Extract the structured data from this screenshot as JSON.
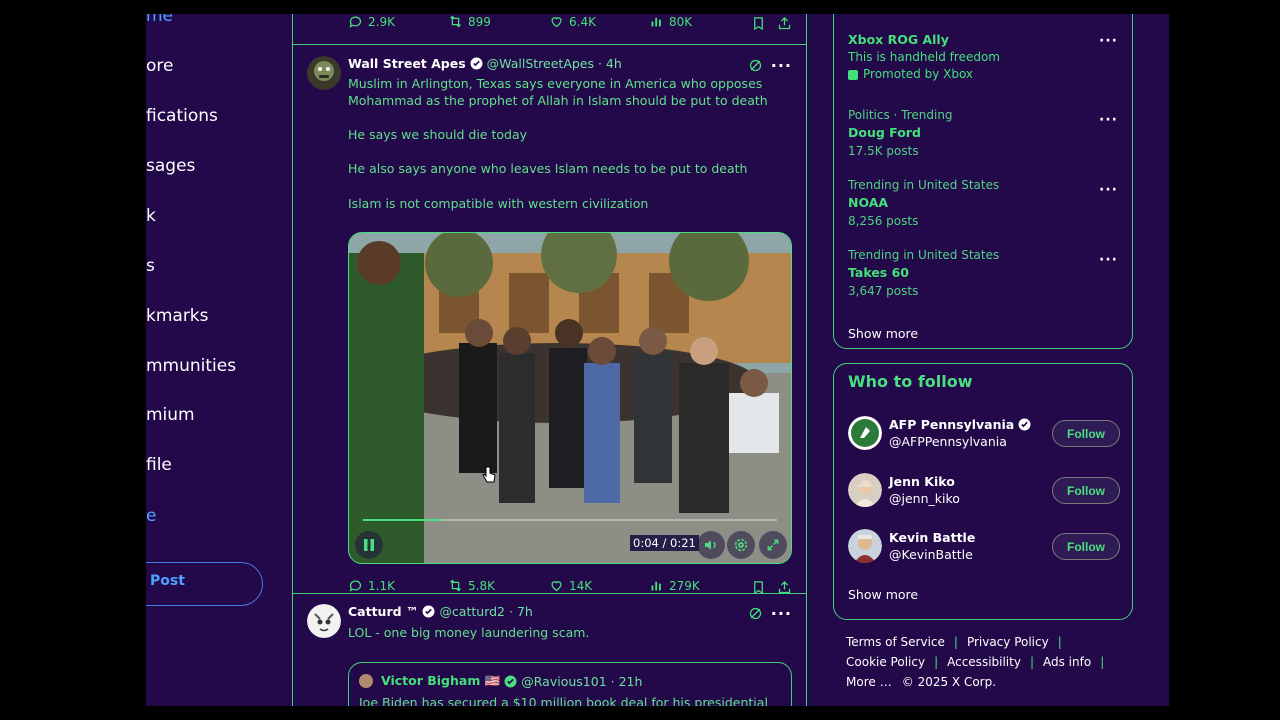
{
  "nav": {
    "items": [
      "me",
      "ore",
      "fications",
      "sages",
      "k",
      "s",
      "kmarks",
      "mmunities",
      "mium",
      "file",
      "e"
    ],
    "post_label": "Post"
  },
  "feed": {
    "top_actions": {
      "replies": "2.9K",
      "reposts": "899",
      "likes": "6.4K",
      "views": "80K"
    },
    "tweet1": {
      "name": "Wall Street Apes",
      "handle": "@WallStreetApes · 4h",
      "paragraphs": [
        "Muslim in Arlington, Texas says everyone in America who opposes Mohammad as the prophet of Allah in Islam should be put to death",
        "He says we should die today",
        "He also says anyone who leaves Islam needs to be put to death",
        "Islam is not compatible with western civilization"
      ],
      "video_time": "0:04 / 0:21",
      "video_progress": 0.19,
      "actions": {
        "replies": "1.1K",
        "reposts": "5.8K",
        "likes": "14K",
        "views": "279K"
      }
    },
    "tweet2": {
      "name": "Catturd ™",
      "handle": "@catturd2 · 7h",
      "text": "LOL - one big money laundering scam.",
      "quote": {
        "name": "Victor Bigham 🇺🇸",
        "handle": "@Ravious101 · 21h",
        "text": "Joe Biden has secured a $10 million book deal for his presidential"
      }
    }
  },
  "trends": {
    "promo": {
      "name": "Xbox ROG Ally",
      "desc": "This is handheld freedom",
      "promoted": "Promoted by Xbox"
    },
    "items": [
      {
        "meta": "Politics · Trending",
        "name": "Doug Ford",
        "posts": "17.5K posts"
      },
      {
        "meta": "Trending in United States",
        "name": "NOAA",
        "posts": "8,256 posts"
      },
      {
        "meta": "Trending in United States",
        "name": "Takes 60",
        "posts": "3,647 posts"
      }
    ],
    "show_more": "Show more"
  },
  "who_to_follow": {
    "title": "Who to follow",
    "accounts": [
      {
        "name": "AFP Pennsylvania",
        "handle": "@AFPPennsylvania",
        "button": "Follow"
      },
      {
        "name": "Jenn Kiko",
        "handle": "@jenn_kiko",
        "button": "Follow"
      },
      {
        "name": "Kevin Battle",
        "handle": "@KevinBattle",
        "button": "Follow"
      }
    ],
    "show_more": "Show more"
  },
  "footer": {
    "links": [
      "Terms of Service",
      "Privacy Policy",
      "Cookie Policy",
      "Accessibility",
      "Ads info",
      "More"
    ],
    "copyright": "© 2025 X Corp."
  },
  "colors": {
    "background": "#23094a",
    "accent": "#4ade80",
    "border": "#44d07a",
    "link_blue": "#4ba3ff"
  }
}
